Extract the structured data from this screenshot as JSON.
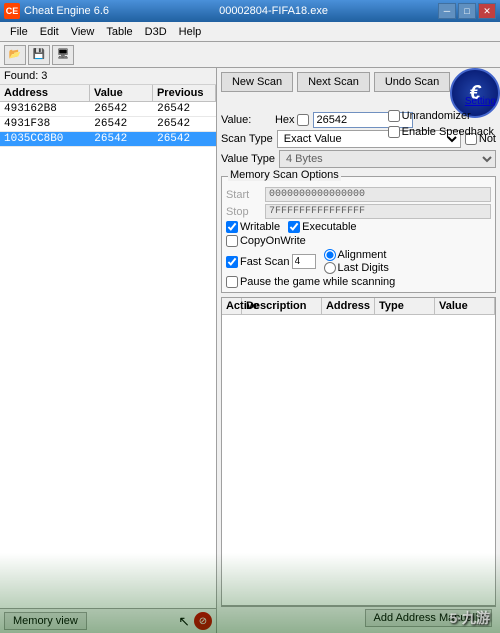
{
  "window": {
    "title": "00002804-FIFA18.exe",
    "app_name": "Cheat Engine 6.6"
  },
  "menu": {
    "items": [
      "File",
      "Edit",
      "View",
      "Table",
      "D3D",
      "Help"
    ]
  },
  "found_count": "Found: 3",
  "table": {
    "headers": [
      "Address",
      "Value",
      "Previous"
    ],
    "rows": [
      {
        "address": "493162B8",
        "value": "26542",
        "previous": "26542",
        "selected": false
      },
      {
        "address": "4931F38",
        "value": "26542",
        "previous": "26542",
        "selected": false
      },
      {
        "address": "1035CC8B0",
        "value": "26542",
        "previous": "26542",
        "selected": true
      }
    ]
  },
  "scan_buttons": {
    "new_scan": "New Scan",
    "next_scan": "Next Scan",
    "undo_scan": "Undo Scan"
  },
  "settings_link": "Setting",
  "value_section": {
    "hex_label": "Hex",
    "value_label": "Value:",
    "value_input": "26542"
  },
  "scan_type": {
    "label": "Scan Type",
    "value": "Exact Value",
    "not_label": "Not"
  },
  "value_type": {
    "label": "Value Type",
    "value": "4 Bytes"
  },
  "memory_scan": {
    "title": "Memory Scan Options",
    "start_label": "Start",
    "start_value": "0000000000000000",
    "stop_label": "Stop",
    "stop_value": "7FFFFFFFFFFFFFFF",
    "writable_label": "Writable",
    "executable_label": "Executable",
    "copyonwrite_label": "CopyOnWrite",
    "fast_scan_label": "Fast Scan",
    "fast_scan_value": "4",
    "alignment_label": "Alignment",
    "last_digits_label": "Last Digits",
    "pause_label": "Pause the game while scanning",
    "unrandomizer_label": "Unrandomizer",
    "enable_speedhack_label": "Enable Speedhack"
  },
  "memory_view_btn": "Memory view",
  "add_address_btn": "Add Address Manually",
  "addr_table": {
    "headers": [
      "Active",
      "Description",
      "",
      "Address",
      "Type",
      "Value"
    ]
  },
  "ce_logo": "€",
  "watermark": "5·九游"
}
